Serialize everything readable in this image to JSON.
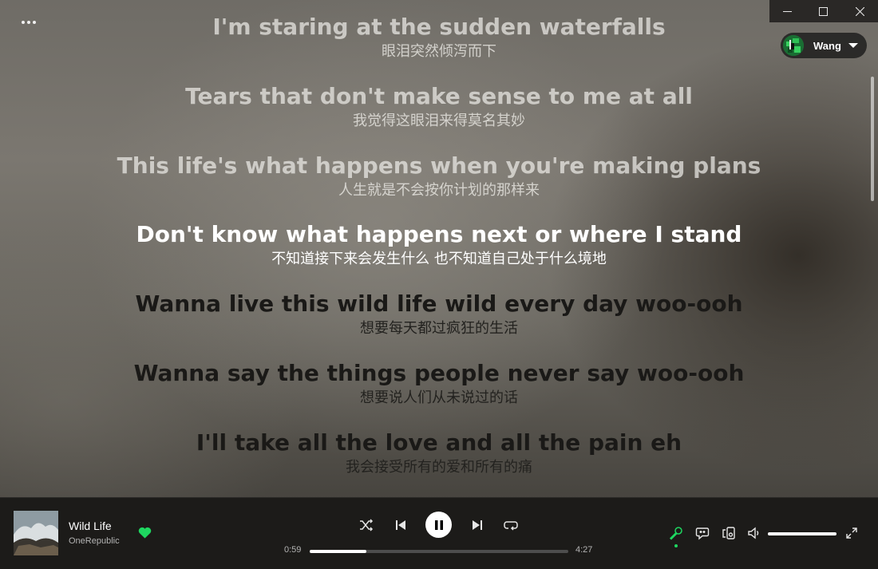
{
  "window": {
    "controls": [
      "minimize-icon",
      "maximize-icon",
      "close-icon"
    ]
  },
  "user": {
    "name": "Wang"
  },
  "lyrics": [
    {
      "en": "I'm staring at the sudden waterfalls",
      "zh": "眼泪突然倾泻而下",
      "state": "past"
    },
    {
      "en": "Tears that don't make sense to me at all",
      "zh": "我觉得这眼泪来得莫名其妙",
      "state": "past"
    },
    {
      "en": "This life's what happens when you're making plans",
      "zh": "人生就是不会按你计划的那样来",
      "state": "past"
    },
    {
      "en": "Don't know what happens next or where I stand",
      "zh": "不知道接下来会发生什么 也不知道自己处于什么境地",
      "state": "current"
    },
    {
      "en": "Wanna live this wild life wild every day woo-ooh",
      "zh": "想要每天都过疯狂的生活",
      "state": "future"
    },
    {
      "en": "Wanna say the things people never say woo-ooh",
      "zh": "想要说人们从未说过的话",
      "state": "future"
    },
    {
      "en": "I'll take all the love and all the pain eh",
      "zh": "我会接受所有的爱和所有的痛",
      "state": "future"
    }
  ],
  "player": {
    "track_title": "Wild Life",
    "artist": "OneRepublic",
    "liked": true,
    "elapsed": "0:59",
    "duration": "4:27",
    "progress_fraction": 0.22,
    "volume_fraction": 1.0,
    "lyrics_active": true
  },
  "colors": {
    "accent": "#1ed760",
    "player_bg": "#1c1b19"
  }
}
